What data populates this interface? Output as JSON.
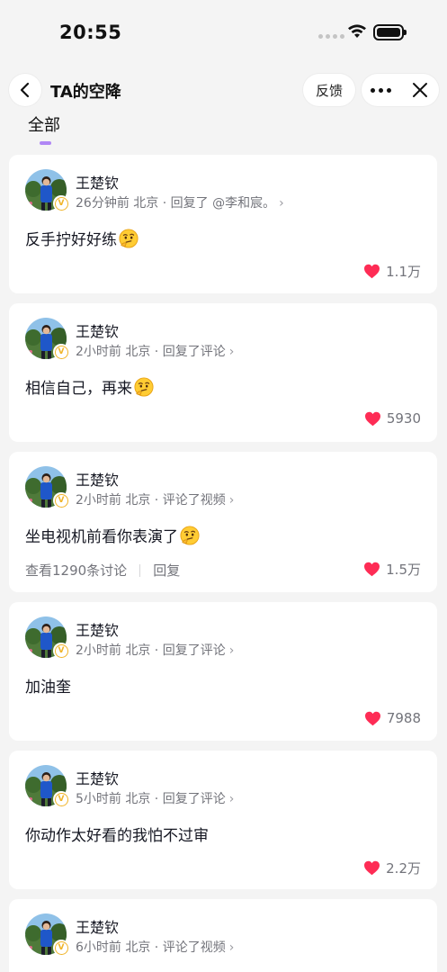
{
  "status_bar": {
    "time": "20:55"
  },
  "nav": {
    "title": "TA的空降",
    "feedback_label": "反馈"
  },
  "tabs": [
    {
      "label": "全部",
      "active": true
    }
  ],
  "colors": {
    "like_heart": "#fe2c55",
    "tab_indicator": "#b087f5",
    "verified_badge": "#f0b429"
  },
  "comments": [
    {
      "user": "王楚钦",
      "meta": "26分钟前 北京 · 回复了 @李和宸。",
      "text": "反手拧好好练",
      "emoji": "thinking-face",
      "likes": "1.1万"
    },
    {
      "user": "王楚钦",
      "meta": "2小时前 北京 · 回复了评论",
      "text": "相信自己，再来",
      "emoji": "thinking-face",
      "likes": "5930"
    },
    {
      "user": "王楚钦",
      "meta": "2小时前 北京 · 评论了视频",
      "text": "坐电视机前看你表演了",
      "emoji": "thinking-face",
      "likes": "1.5万",
      "discussion": "查看1290条讨论",
      "reply": "回复"
    },
    {
      "user": "王楚钦",
      "meta": "2小时前 北京 · 回复了评论",
      "text": "加油奎",
      "likes": "7988"
    },
    {
      "user": "王楚钦",
      "meta": "5小时前 北京 · 回复了评论",
      "text": "你动作太好看的我怕不过审",
      "likes": "2.2万"
    },
    {
      "user": "王楚钦",
      "meta": "6小时前 北京 · 评论了视频"
    }
  ]
}
